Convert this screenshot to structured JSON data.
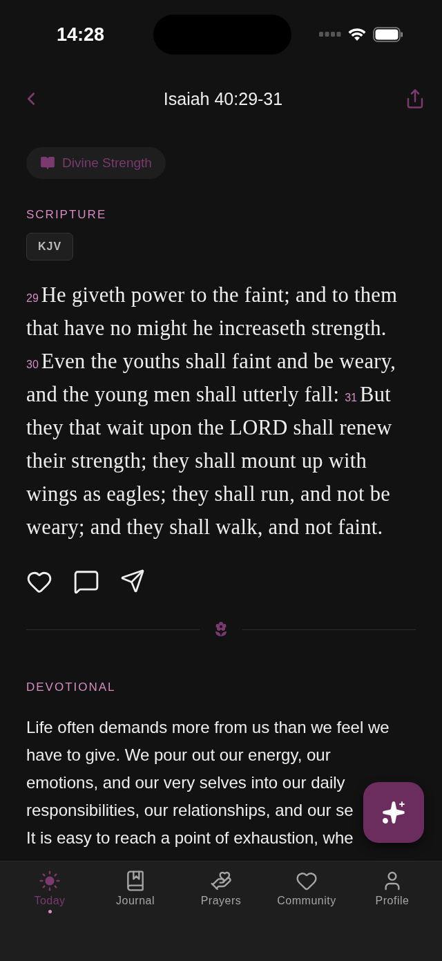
{
  "status_bar": {
    "time": "14:28"
  },
  "header": {
    "title": "Isaiah 40:29-31"
  },
  "theme_chip": {
    "label": "Divine Strength"
  },
  "scripture": {
    "heading": "SCRIPTURE",
    "translation": "KJV",
    "verses": [
      {
        "number": "29",
        "text": "He giveth power to the faint; and to them that have no might he increaseth strength."
      },
      {
        "number": "30",
        "text": "Even the youths shall faint and be weary, and the young men shall utterly fall:"
      },
      {
        "number": "31",
        "text": "But they that wait upon the LORD shall renew their strength; they shall mount up with wings as eagles; they shall run, and not be weary; and they shall walk, and not faint."
      }
    ]
  },
  "devotional": {
    "heading": "DEVOTIONAL",
    "lines": [
      "Life often demands more from us than we feel we",
      "have to give. We pour out our energy, our",
      "emotions, and our very selves into our daily",
      "responsibilities, our relationships, and our se",
      "It is easy to reach a point of exhaustion, whe"
    ]
  },
  "tabs": [
    {
      "label": "Today",
      "kind": "sun",
      "selected": true
    },
    {
      "label": "Journal",
      "kind": "book",
      "selected": false
    },
    {
      "label": "Prayers",
      "kind": "hand",
      "selected": false
    },
    {
      "label": "Community",
      "kind": "heart",
      "selected": false
    },
    {
      "label": "Profile",
      "kind": "user",
      "selected": false
    }
  ]
}
